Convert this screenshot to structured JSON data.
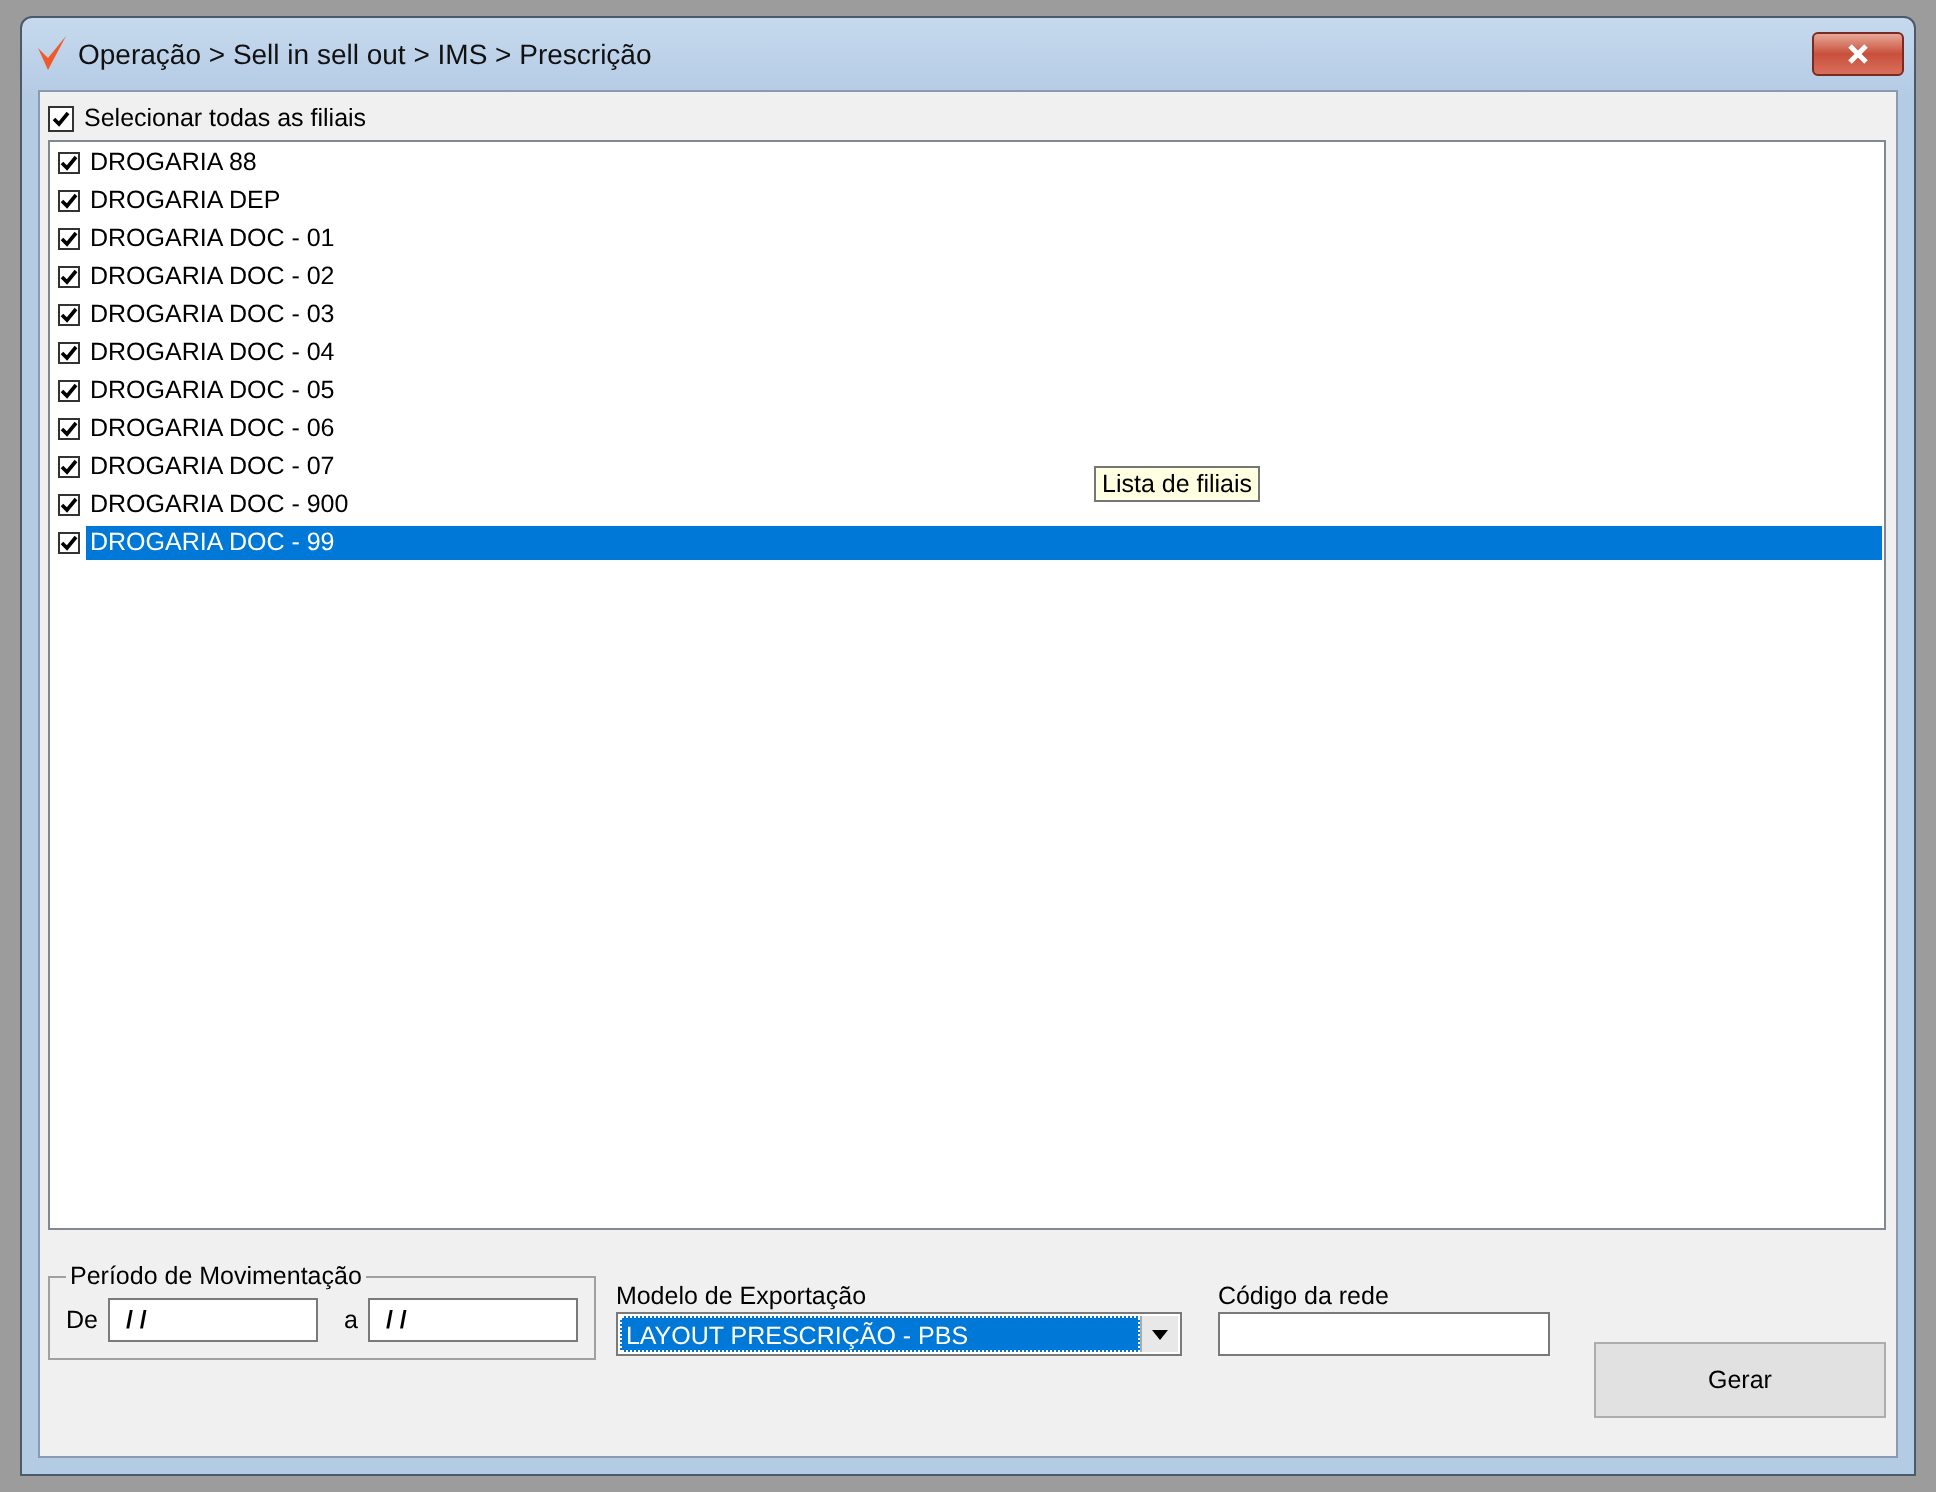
{
  "window": {
    "title": "Operação > Sell in sell out > IMS > Prescrição"
  },
  "select_all": {
    "label": "Selecionar todas as filiais",
    "checked": true
  },
  "branches": [
    {
      "label": "DROGARIA 88",
      "checked": true,
      "selected": false
    },
    {
      "label": "DROGARIA DEP",
      "checked": true,
      "selected": false
    },
    {
      "label": "DROGARIA DOC - 01",
      "checked": true,
      "selected": false
    },
    {
      "label": "DROGARIA DOC - 02",
      "checked": true,
      "selected": false
    },
    {
      "label": "DROGARIA DOC - 03",
      "checked": true,
      "selected": false
    },
    {
      "label": "DROGARIA DOC - 04",
      "checked": true,
      "selected": false
    },
    {
      "label": "DROGARIA DOC - 05",
      "checked": true,
      "selected": false
    },
    {
      "label": "DROGARIA DOC - 06",
      "checked": true,
      "selected": false
    },
    {
      "label": "DROGARIA DOC - 07",
      "checked": true,
      "selected": false
    },
    {
      "label": "DROGARIA DOC - 900",
      "checked": true,
      "selected": false
    },
    {
      "label": "DROGARIA DOC - 99",
      "checked": true,
      "selected": true
    }
  ],
  "tooltip": "Lista de filiais",
  "period": {
    "legend": "Período de Movimentação",
    "from_label": "De",
    "from_value": "/ /",
    "to_label": "a",
    "to_value": "/ /"
  },
  "export_model": {
    "label": "Modelo de Exportação",
    "value": "LAYOUT PRESCRIÇÃO - PBS"
  },
  "network_code": {
    "label": "Código da rede"
  },
  "button": "Gerar"
}
